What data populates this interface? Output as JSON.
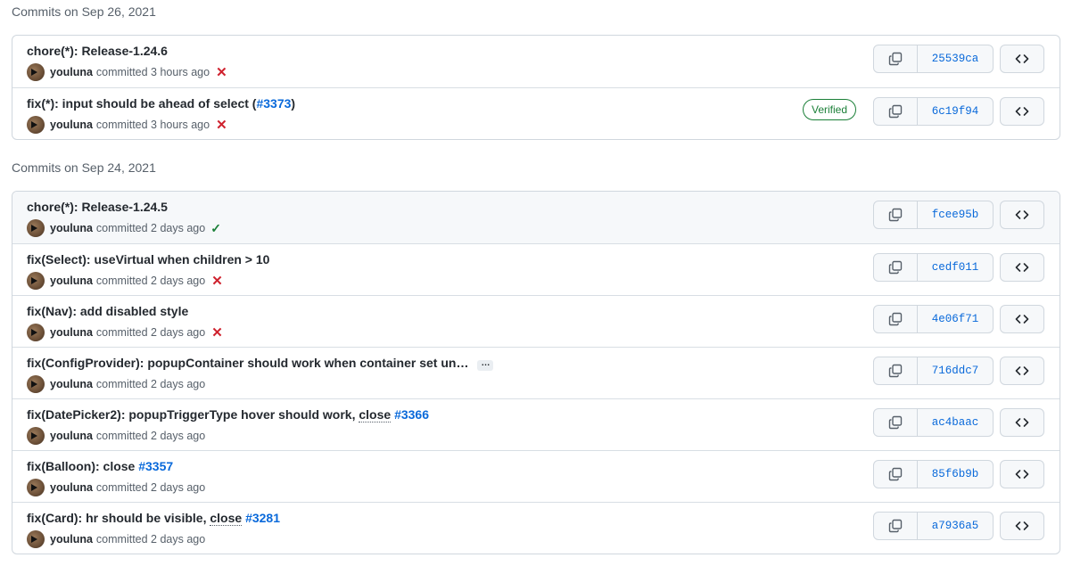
{
  "groups": [
    {
      "title": "Commits on Sep 26, 2021",
      "commits": [
        {
          "message": "chore(*): Release-1.24.6",
          "author": "youluna",
          "time": "committed 3 hours ago",
          "status": "failure",
          "sha": "25539ca"
        },
        {
          "message_prefix": "fix(*): input should be ahead of select (",
          "link": "#3373",
          "message_suffix": ")",
          "author": "youluna",
          "time": "committed 3 hours ago",
          "status": "failure",
          "badge": "Verified",
          "sha": "6c19f94"
        }
      ]
    },
    {
      "title": "Commits on Sep 24, 2021",
      "commits": [
        {
          "message": "chore(*): Release-1.24.5",
          "author": "youluna",
          "time": "committed 2 days ago",
          "status": "success",
          "sha": "fcee95b"
        },
        {
          "message": "fix(Select): useVirtual when children > 10",
          "author": "youluna",
          "time": "committed 2 days ago",
          "status": "failure",
          "sha": "cedf011"
        },
        {
          "message": "fix(Nav): add disabled style",
          "author": "youluna",
          "time": "committed 2 days ago",
          "status": "failure",
          "sha": "4e06f71"
        },
        {
          "message": "fix(ConfigProvider): popupContainer should work when container set un…",
          "ellipsis": "…",
          "author": "youluna",
          "time": "committed 2 days ago",
          "sha": "716ddc7"
        },
        {
          "message_prefix": "fix(DatePicker2): popupTriggerType hover should work, ",
          "close_word": "close",
          "link": "#3366",
          "author": "youluna",
          "time": "committed 2 days ago",
          "sha": "ac4baac"
        },
        {
          "message_prefix": "fix(Balloon): close ",
          "link": "#3357",
          "author": "youluna",
          "time": "committed 2 days ago",
          "sha": "85f6b9b"
        },
        {
          "message_prefix": "fix(Card): hr should be visible, ",
          "close_word": "close",
          "link": "#3281",
          "author": "youluna",
          "time": "committed 2 days ago",
          "sha": "a7936a5"
        }
      ]
    }
  ],
  "icons": {
    "copy": "copy-icon",
    "browse": "code-icon",
    "failure": "x-icon",
    "success": "check-icon"
  },
  "colors": {
    "link": "#0969da",
    "failure": "#cf222e",
    "success": "#1a7f37",
    "muted": "#57606a"
  }
}
